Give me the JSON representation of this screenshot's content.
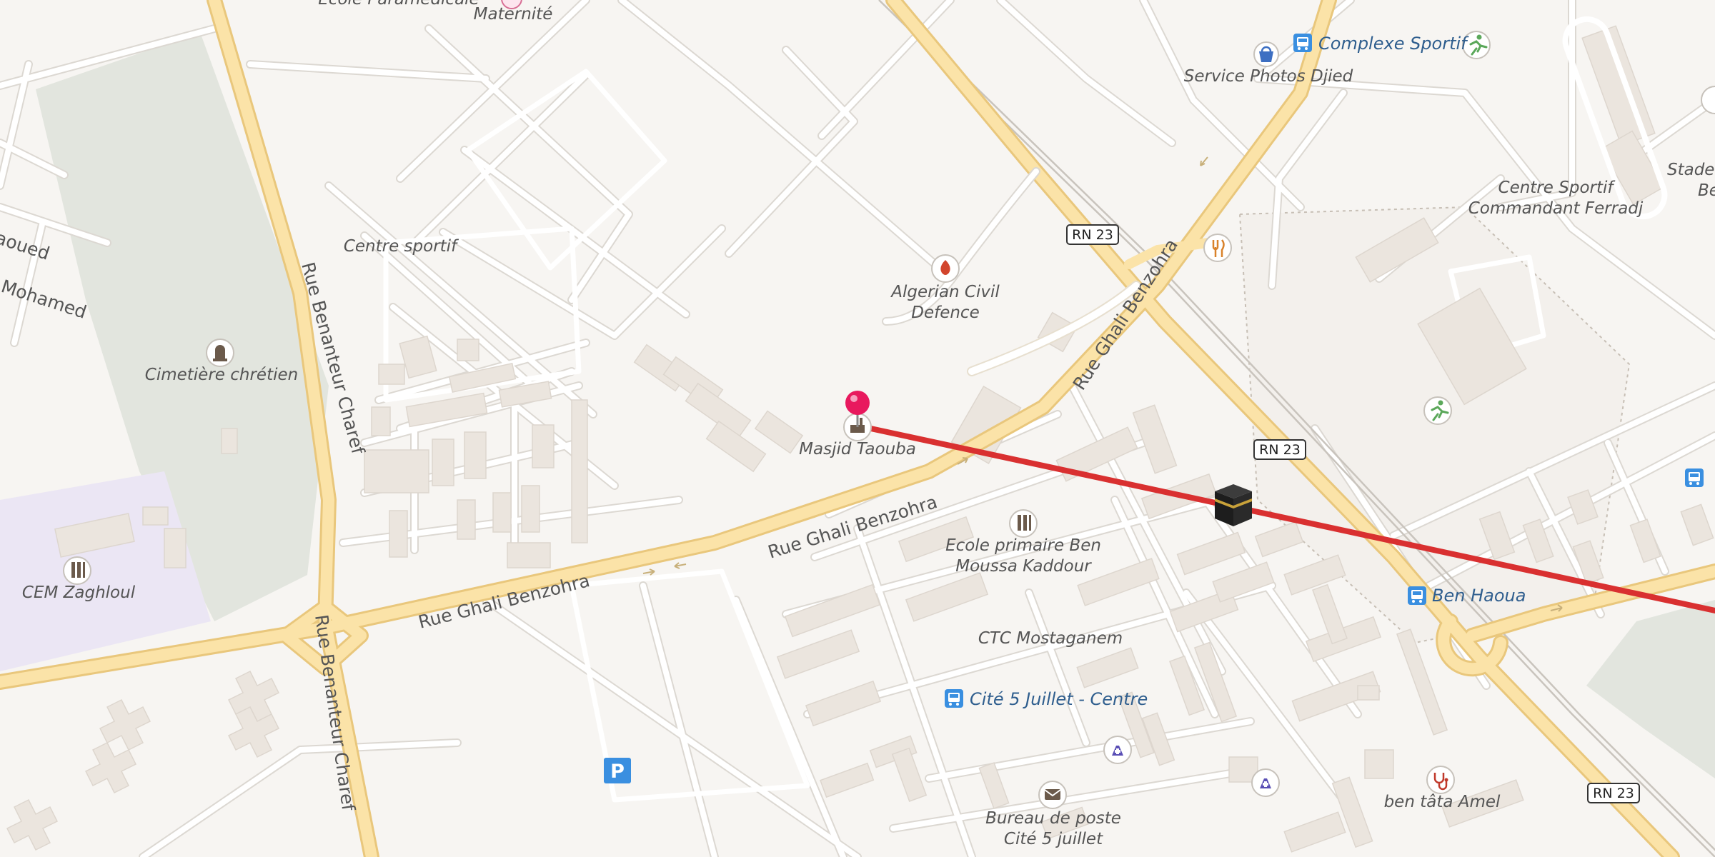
{
  "map": {
    "places": {
      "maternite": "Maternité",
      "ecole_paramedicale": "Ecole Paramédicale",
      "complexe_sportif": "Complexe Sportif",
      "service_photos": "Service Photos Djied",
      "stade": "Stade I",
      "stade_2": "Be",
      "centre_sportif": "Centre sportif",
      "centre_sportif_cmdt_1": "Centre Sportif",
      "centre_sportif_cmdt_2": "Commandant Ferradj",
      "civil_defence_1": "Algerian Civil",
      "civil_defence_2": "Defence",
      "masjid": "Masjid Taouba",
      "cimetiere": "Cimetière chrétien",
      "cem": "CEM Zaghloul",
      "ecole_primaire_1": "Ecole primaire Ben",
      "ecole_primaire_2": "Moussa Kaddour",
      "ctc": "CTC Mostaganem",
      "cite_5_juillet": "Cité 5 Juillet - Centre",
      "ben_haoua": "Ben Haoua",
      "bureau_poste_1": "Bureau de poste",
      "bureau_poste_2": "Cité 5 juillet",
      "ben_tata": "ben tâta Amel",
      "aoued": "aoued",
      "mohamed": "Mohamed"
    },
    "roads": {
      "rue_benanteur_1": "Rue Benanteur Charef",
      "rue_benanteur_2": "Rue Benanteur Charef",
      "rue_ghali_1": "Rue Ghali Benzohra",
      "rue_ghali_2": "Rue Ghali Benzohra",
      "rue_ghali_3": "Rue Ghali Benzohra",
      "rn23_1": "RN 23",
      "rn23_2": "RN 23",
      "rn23_3": "RN 23"
    },
    "parking_symbol": "P",
    "icons": {
      "pin": "location-pin-icon",
      "kaaba": "kaaba-icon",
      "route_line": "qibla-direction-line"
    },
    "colors": {
      "route_line": "#d93030",
      "pin": "#e8195e",
      "main_road": "#fbe3a8",
      "transit": "#3a8fe0",
      "background": "#f7f5f2",
      "park": "#e2e5de",
      "school_area": "#ebe6f4"
    }
  }
}
